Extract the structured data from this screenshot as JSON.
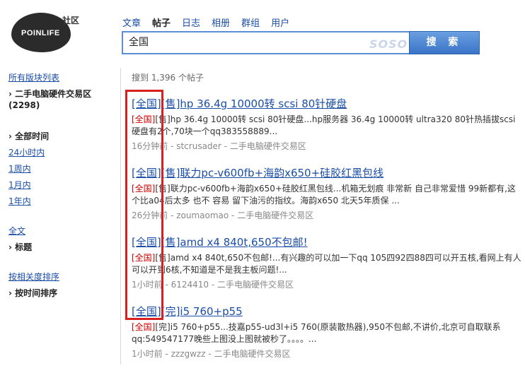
{
  "logo": {
    "brand": "POINLIFE",
    "community": "社区"
  },
  "nav": {
    "tabs": [
      "文章",
      "帖子",
      "日志",
      "相册",
      "群组",
      "用户"
    ],
    "active_index": 1
  },
  "search": {
    "value": "全国",
    "provider": "SOSO",
    "button_label": "搜 索"
  },
  "sidebar": {
    "all_boards": "所有版块列表",
    "board_name": "二手电脑硬件交易区",
    "board_count": "(2298)",
    "time_heading": "全部时间",
    "time_24h": "24小时内",
    "time_1w": "1周内",
    "time_1m": "1月内",
    "time_1y": "1年内",
    "scope_full": "全文",
    "scope_title": "标题",
    "sort_relevance": "按相关度排序",
    "sort_time": "按时间排序"
  },
  "results": {
    "count_text": "搜到 1,396 个帖子",
    "items": [
      {
        "tag": "[全国]",
        "title": "[售]hp 36.4g 10000转 scsi 80针硬盘",
        "snippet_tag": "[全国]",
        "snippet": "[售]hp 36.4g 10000转 scsi 80针硬盘...hp服务器 36.4g 10000转 ultra320 80针热插拔scsi硬盘有2个,70块一个qq383558889...",
        "meta": "16分钟前 - stcrusader - 二手电脑硬件交易区"
      },
      {
        "tag": "[全国]",
        "title": "[售]联力pc-v600fb+海韵x650+硅胶红黑包线",
        "snippet_tag": "[全国]",
        "snippet": "[售]联力pc-v600fb+海韵x650+硅胶红黑包线...机箱无划痕 非常新 自己非常爱惜 99新都有,这个比a04后太多 也不 容易 留下油污的指纹。海韵x650 北天5年质保 ...",
        "meta": "26分钟前 - zoumaomao - 二手电脑硬件交易区"
      },
      {
        "tag": "[全国]",
        "title": "[售]amd x4 840t,650不包邮!",
        "snippet_tag": "[全国]",
        "snippet": "[售]amd x4 840t,650不包邮!...有兴趣的可以加一下qq 105四92四88四可以开五核,看网上有人可以开到6核,不知道是不是我主板问题!...",
        "meta": "1小时前 - 6124410 - 二手电脑硬件交易区"
      },
      {
        "tag": "[全国]",
        "title": "[完]i5 760+p55",
        "snippet_tag": "[全国]",
        "snippet": "[完]i5 760+p55...技嘉p55-ud3l+i5 760(原装散热器),950不包邮,不讲价,北京可自取联系qq:549547177晚些上图没上图就被秒了。。。。...",
        "meta": "1小时前 - zzzgwzz - 二手电脑硬件交易区"
      }
    ]
  },
  "colors": {
    "link": "#1a4ea8",
    "highlight_box": "#d9201f",
    "search_button": "#3a74c8"
  }
}
